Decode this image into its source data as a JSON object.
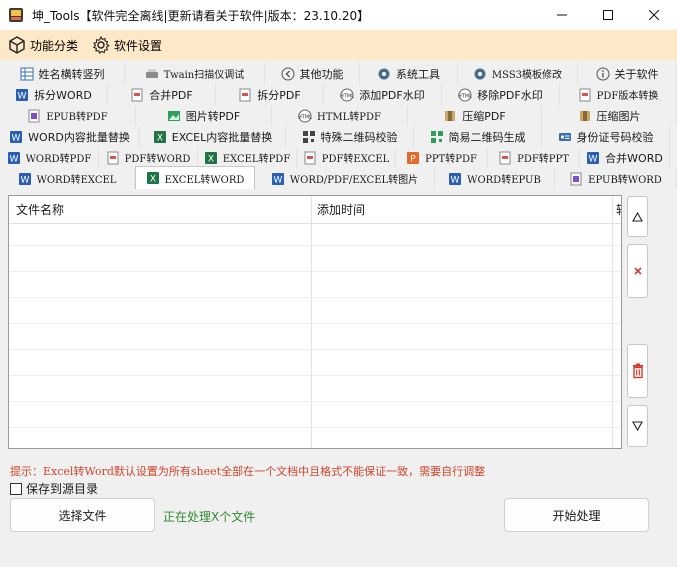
{
  "window": {
    "title": "坤_Tools【软件完全离线|更新请看关于软件|版本：23.10.20】",
    "controls": [
      "minimize",
      "maximize",
      "close"
    ]
  },
  "menu": {
    "items": [
      {
        "label": "功能分类",
        "icon": "cube-icon"
      },
      {
        "label": "软件设置",
        "icon": "gear-icon"
      }
    ]
  },
  "tabs": {
    "row1": [
      {
        "label": "姓名横转竖列",
        "icon": "table-icon"
      },
      {
        "label": "Twain扫描仪调试",
        "icon": "scanner-icon"
      },
      {
        "label": "其他功能",
        "icon": "back-icon"
      },
      {
        "label": "系统工具",
        "icon": "gear-icon"
      },
      {
        "label": "MSS3模板修改",
        "icon": "gear-icon"
      },
      {
        "label": "关于软件",
        "icon": "info-icon"
      }
    ],
    "row2": [
      {
        "label": "拆分WORD",
        "icon": "word-icon"
      },
      {
        "label": "合并PDF",
        "icon": "pdf-icon"
      },
      {
        "label": "拆分PDF",
        "icon": "pdf-icon"
      },
      {
        "label": "添加PDF水印",
        "icon": "html-icon"
      },
      {
        "label": "移除PDF水印",
        "icon": "html-icon"
      },
      {
        "label": "PDF版本转换",
        "icon": "pdf-icon"
      }
    ],
    "row3": [
      {
        "label": "EPUB转PDF",
        "icon": "epub-icon"
      },
      {
        "label": "图片转PDF",
        "icon": "image-icon"
      },
      {
        "label": "HTML转PDF",
        "icon": "html-icon"
      },
      {
        "label": "压缩PDF",
        "icon": "compress-icon"
      },
      {
        "label": "压缩图片",
        "icon": "compress-icon"
      }
    ],
    "row4": [
      {
        "label": "WORD内容批量替换",
        "icon": "word-icon"
      },
      {
        "label": "EXCEL内容批量替换",
        "icon": "excel-icon"
      },
      {
        "label": "特殊二维码校验",
        "icon": "qr-icon"
      },
      {
        "label": "简易二维码生成",
        "icon": "qr-icon"
      },
      {
        "label": "身份证号码校验",
        "icon": "id-card-icon"
      }
    ],
    "row5": [
      {
        "label": "WORD转PDF",
        "icon": "word-icon"
      },
      {
        "label": "PDF转WORD",
        "icon": "pdf-icon"
      },
      {
        "label": "EXCEL转PDF",
        "icon": "excel-icon"
      },
      {
        "label": "PDF转EXCEL",
        "icon": "pdf-icon"
      },
      {
        "label": "PPT转PDF",
        "icon": "ppt-icon"
      },
      {
        "label": "PDF转PPT",
        "icon": "pdf-icon"
      },
      {
        "label": "合并WORD",
        "icon": "word-icon"
      }
    ],
    "row6": [
      {
        "label": "WORD转EXCEL",
        "icon": "word-icon"
      },
      {
        "label": "EXCEL转WORD",
        "icon": "excel-icon",
        "active": true
      },
      {
        "label": "WORD/PDF/EXCEL转图片",
        "icon": "word-icon"
      },
      {
        "label": "WORD转EPUB",
        "icon": "word-icon"
      },
      {
        "label": "EPUB转WORD",
        "icon": "epub-icon"
      }
    ]
  },
  "file_list": {
    "columns": [
      "文件名称",
      "添加时间",
      "转"
    ],
    "rows": []
  },
  "side_buttons": [
    "move-up",
    "remove",
    "clear-all",
    "move-down"
  ],
  "hint": "提示：Excel转Word默认设置为所有sheet全部在一个文档中且格式不能保证一致，需要自行调整",
  "save_to_source": {
    "label": "保存到源目录",
    "checked": false
  },
  "buttons": {
    "select_files": "选择文件",
    "start": "开始处理"
  },
  "status": "正在处理X个文件",
  "colors": {
    "menu_bg": "#fde8c8",
    "hint": "#d2442a",
    "status": "#2f8a2f",
    "word": "#2b5fb4",
    "excel": "#217346",
    "pdf": "#d9534f",
    "ppt": "#e46c2b"
  }
}
